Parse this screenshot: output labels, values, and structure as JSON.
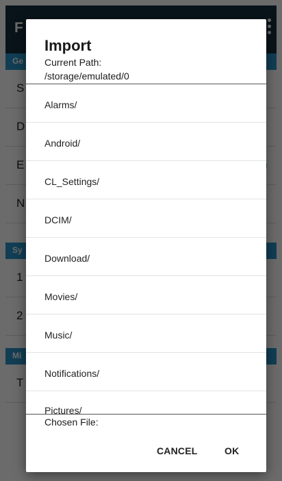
{
  "background": {
    "app_title_initial": "F",
    "sections": [
      {
        "label": "Ge"
      },
      {
        "label": "Sy"
      },
      {
        "label": "Mi"
      }
    ],
    "rows": [
      "S",
      "D",
      "E",
      "N",
      "1",
      "2",
      "T"
    ]
  },
  "dialog": {
    "title": "Import",
    "current_path_label": "Current Path:",
    "current_path": "/storage/emulated/0",
    "items": [
      "Alarms/",
      "Android/",
      "CL_Settings/",
      "DCIM/",
      "Download/",
      "Movies/",
      "Music/",
      "Notifications/",
      "Pictures/"
    ],
    "chosen_file_label": "Chosen File:",
    "cancel_label": "CANCEL",
    "ok_label": "OK"
  },
  "colors": {
    "app_bar": "#17303e",
    "section_header": "#2a93c8",
    "toggle_on": "#2bb673"
  }
}
